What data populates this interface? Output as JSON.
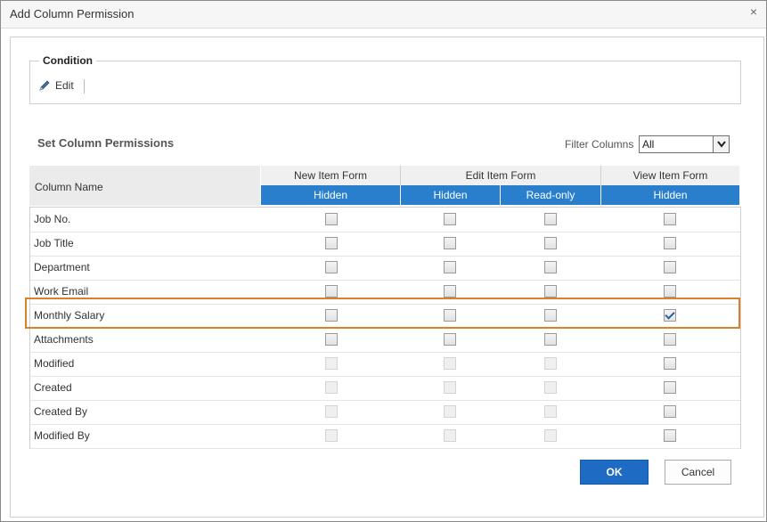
{
  "dialog": {
    "title": "Add Column Permission",
    "close_glyph": "×"
  },
  "condition": {
    "legend": "Condition",
    "edit_label": "Edit"
  },
  "permissions": {
    "title": "Set Column Permissions",
    "filter_label": "Filter Columns",
    "filter_value": "All"
  },
  "header": {
    "column_name": "Column Name",
    "groups": [
      "New Item Form",
      "Edit Item Form",
      "View Item Form"
    ],
    "subs": [
      "Hidden",
      "Hidden",
      "Read-only",
      "Hidden"
    ]
  },
  "rows": [
    {
      "name": "Job No.",
      "checks": [
        false,
        false,
        false,
        false
      ],
      "disabled": [
        false,
        false,
        false,
        false
      ]
    },
    {
      "name": "Job Title",
      "checks": [
        false,
        false,
        false,
        false
      ],
      "disabled": [
        false,
        false,
        false,
        false
      ]
    },
    {
      "name": "Department",
      "checks": [
        false,
        false,
        false,
        false
      ],
      "disabled": [
        false,
        false,
        false,
        false
      ]
    },
    {
      "name": "Work Email",
      "checks": [
        false,
        false,
        false,
        false
      ],
      "disabled": [
        false,
        false,
        false,
        false
      ]
    },
    {
      "name": "Monthly Salary",
      "checks": [
        false,
        false,
        false,
        true
      ],
      "disabled": [
        false,
        false,
        false,
        false
      ]
    },
    {
      "name": "Attachments",
      "checks": [
        false,
        false,
        false,
        false
      ],
      "disabled": [
        false,
        false,
        false,
        false
      ]
    },
    {
      "name": "Modified",
      "checks": [
        false,
        false,
        false,
        false
      ],
      "disabled": [
        true,
        true,
        true,
        false
      ]
    },
    {
      "name": "Created",
      "checks": [
        false,
        false,
        false,
        false
      ],
      "disabled": [
        true,
        true,
        true,
        false
      ]
    },
    {
      "name": "Created By",
      "checks": [
        false,
        false,
        false,
        false
      ],
      "disabled": [
        true,
        true,
        true,
        false
      ]
    },
    {
      "name": "Modified By",
      "checks": [
        false,
        false,
        false,
        false
      ],
      "disabled": [
        true,
        true,
        true,
        false
      ]
    }
  ],
  "buttons": {
    "ok": "OK",
    "cancel": "Cancel"
  },
  "colors": {
    "accent": "#2a7fcc",
    "ok_button": "#1d6bc2",
    "highlight": "#d9822b"
  }
}
